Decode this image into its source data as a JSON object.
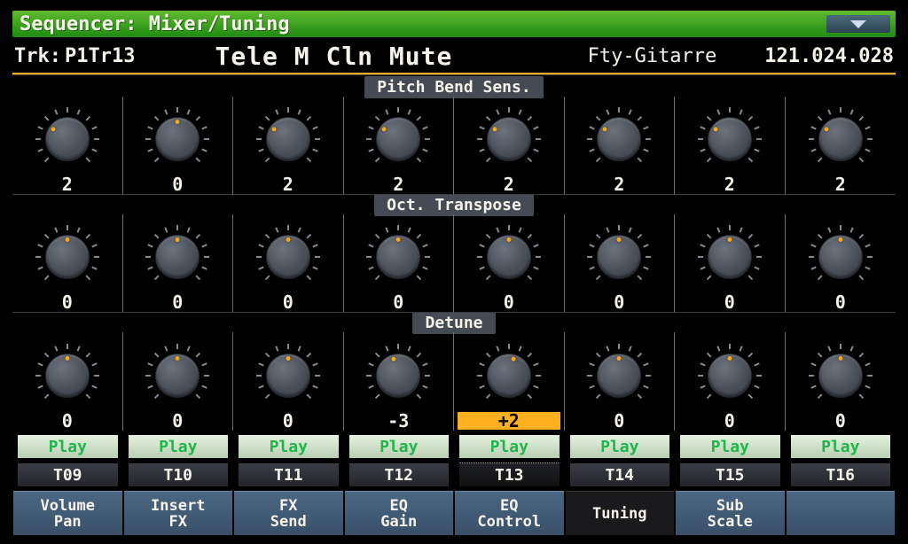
{
  "titlebar": {
    "title": "Sequencer: Mixer/Tuning"
  },
  "infobar": {
    "trk_label": "Trk:",
    "trk_name": "P1Tr13",
    "patch_name": "Tele M Cln Mute",
    "category": "Fty-Gitarre",
    "program_number": "121.024.028"
  },
  "section_labels": {
    "pitch_bend": "Pitch Bend Sens.",
    "oct_transpose": "Oct. Transpose",
    "detune": "Detune"
  },
  "tracks": [
    "T09",
    "T10",
    "T11",
    "T12",
    "T13",
    "T14",
    "T15",
    "T16"
  ],
  "selected_track_index": 4,
  "rows": {
    "pitch_bend": [
      "2",
      "0",
      "2",
      "2",
      "2",
      "2",
      "2",
      "2"
    ],
    "oct_transpose": [
      "0",
      "0",
      "0",
      "0",
      "0",
      "0",
      "0",
      "0"
    ],
    "detune": [
      "0",
      "0",
      "0",
      "-3",
      "+2",
      "0",
      "0",
      "0"
    ]
  },
  "selected_cell": {
    "row": "detune",
    "col": 4
  },
  "play_label": "Play",
  "page_tabs": [
    "Volume\nPan",
    "Insert\nFX",
    "FX\nSend",
    "EQ\nGain",
    "EQ\nControl",
    "Tuning",
    "Sub\nScale",
    ""
  ],
  "selected_page_tab": 5
}
